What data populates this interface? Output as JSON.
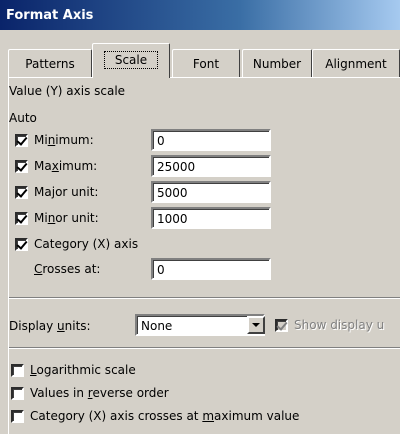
{
  "window": {
    "title": "Format Axis"
  },
  "tabs": [
    {
      "label": "Patterns"
    },
    {
      "label": "Scale"
    },
    {
      "label": "Font"
    },
    {
      "label": "Number"
    },
    {
      "label": "Alignment"
    }
  ],
  "scale": {
    "heading": "Value (Y) axis scale",
    "auto_label": "Auto",
    "minimum": {
      "label_pre": "Mi",
      "label_u": "n",
      "label_post": "imum:",
      "value": "0",
      "checked": true
    },
    "maximum": {
      "label_pre": "Ma",
      "label_u": "x",
      "label_post": "imum:",
      "value": "25000",
      "checked": true
    },
    "major": {
      "label_pre": "Ma",
      "label_u": "j",
      "label_post": "or unit:",
      "value": "5000",
      "checked": true
    },
    "minor": {
      "label_pre": "Mi",
      "label_u": "n",
      "label_post": "or unit:",
      "value": "1000",
      "checked": true
    },
    "category_axis": {
      "label": "Category (X) axis",
      "checked": true
    },
    "crosses": {
      "label_u": "C",
      "label_post": "rosses at:",
      "value": "0"
    },
    "display_units": {
      "label_pre": "Display ",
      "label_u": "u",
      "label_post": "nits:",
      "selected": "None"
    },
    "show_display_units": {
      "label": "Show display u",
      "checked": true,
      "disabled": true
    },
    "log_scale": {
      "label_u": "L",
      "label_post": "ogarithmic scale",
      "checked": false
    },
    "reverse_order": {
      "label_pre": "Values in ",
      "label_u": "r",
      "label_post": "everse order",
      "checked": false
    },
    "crosses_max": {
      "label_pre": "Category (X) axis crosses at ",
      "label_u": "m",
      "label_post": "aximum value",
      "checked": false
    }
  }
}
